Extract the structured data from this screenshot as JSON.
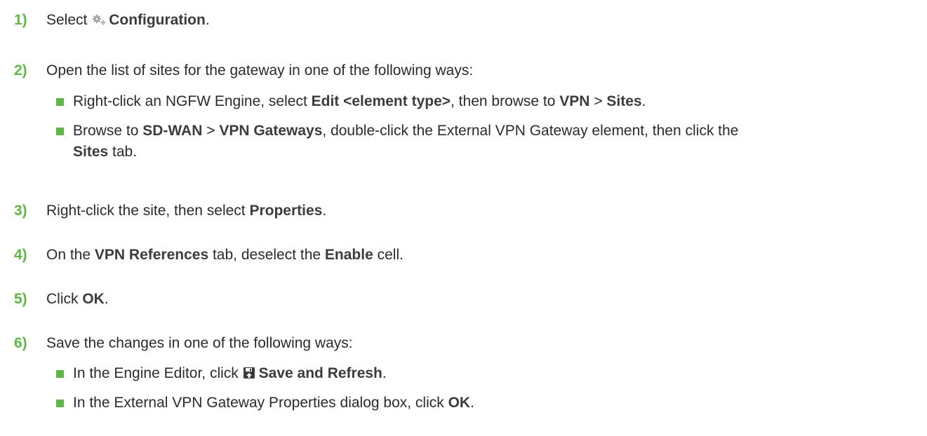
{
  "steps": [
    {
      "num": "1)",
      "parts": [
        "Select ",
        "Configuration",
        "."
      ]
    },
    {
      "num": "2)",
      "text": "Open the list of sites for the gateway in one of the following ways:",
      "bullets": [
        {
          "parts": [
            "Right-click an NGFW Engine, select ",
            "Edit <element type>",
            ", then browse to ",
            "VPN",
            " > ",
            "Sites",
            "."
          ]
        },
        {
          "parts": [
            "Browse to ",
            "SD-WAN",
            " > ",
            "VPN Gateways",
            ", double-click the External VPN Gateway element, then click the"
          ],
          "parts2": [
            "Sites",
            " tab."
          ]
        }
      ]
    },
    {
      "num": "3)",
      "parts": [
        "Right-click the site, then select ",
        "Properties",
        "."
      ]
    },
    {
      "num": "4)",
      "parts": [
        "On the ",
        "VPN References",
        " tab, deselect the ",
        "Enable",
        " cell."
      ]
    },
    {
      "num": "5)",
      "parts": [
        "Click ",
        "OK",
        "."
      ]
    },
    {
      "num": "6)",
      "text": "Save the changes in one of the following ways:",
      "bullets": [
        {
          "parts": [
            "In the Engine Editor, click ",
            "Save and Refresh",
            "."
          ]
        },
        {
          "parts": [
            "In the External VPN Gateway Properties dialog box, click ",
            "OK",
            "."
          ]
        }
      ]
    }
  ],
  "icons": {
    "configuration": "gear-icon",
    "save_refresh": "save-and-refresh-icon"
  },
  "colors": {
    "accent": "#5fb846",
    "text": "#2b2b2b"
  }
}
